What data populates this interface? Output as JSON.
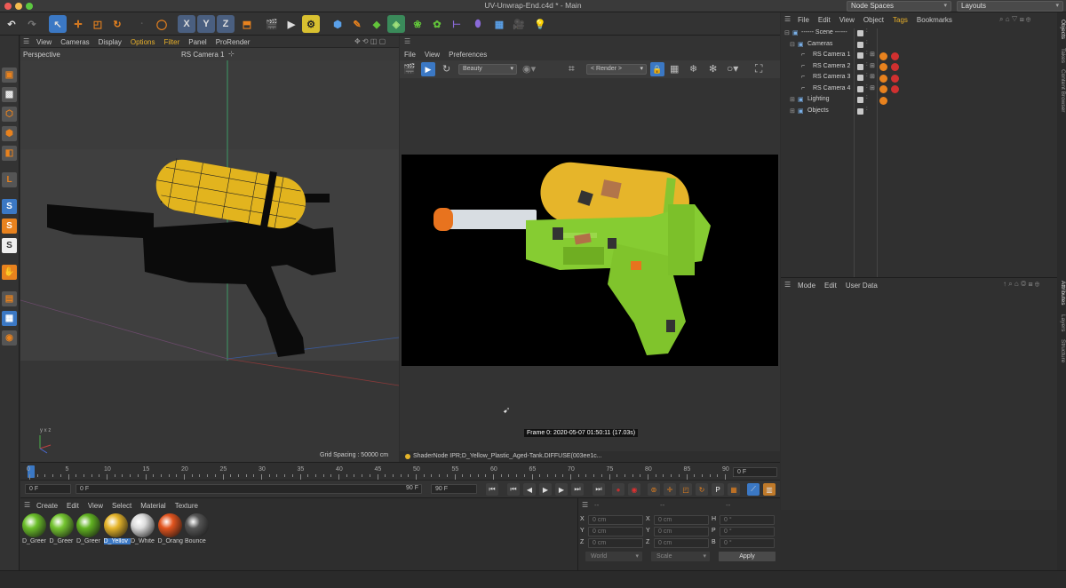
{
  "window": {
    "title": "UV-Unwrap-End.c4d * - Main",
    "node_spaces": "Node Spaces",
    "layouts": "Layouts"
  },
  "colors": {
    "accent_blue": "#3b78c4",
    "red_tag": "#d03030",
    "orange": "#e8821e",
    "yellow": "#e8c12c",
    "green": "#8bd13a"
  },
  "viewport1": {
    "menu": [
      "View",
      "Cameras",
      "Display",
      "Options",
      "Filter",
      "Panel",
      "ProRender"
    ],
    "label": "Perspective",
    "camera": "RS Camera 1",
    "grid_spacing": "Grid Spacing : 50000 cm"
  },
  "render_view": {
    "menu": [
      "File",
      "View",
      "Preferences"
    ],
    "pass": "Beauty",
    "render_dd": "< Render >",
    "frame_info": "Frame  0:  2020-05-07  01:50:11  (17.03s)",
    "shader_info": "ShaderNode IPR;D_Yellow_Plastic_Aged-Tank.DIFFUSE(003ee1c..."
  },
  "object_manager": {
    "menu": [
      "File",
      "Edit",
      "View",
      "Object",
      "Tags",
      "Bookmarks"
    ],
    "rows": [
      {
        "label": "------ Scene ------",
        "indent": 0
      },
      {
        "label": "Cameras",
        "indent": 1
      },
      {
        "label": "RS Camera 1",
        "indent": 2
      },
      {
        "label": "RS Camera 2",
        "indent": 2
      },
      {
        "label": "RS Camera 3",
        "indent": 2
      },
      {
        "label": "RS Camera 4",
        "indent": 2
      },
      {
        "label": "Lighting",
        "indent": 1
      },
      {
        "label": "Objects",
        "indent": 1
      }
    ]
  },
  "attributes": {
    "menu": [
      "Mode",
      "Edit",
      "User Data"
    ]
  },
  "side_tabs": {
    "top": [
      "Objects",
      "Takes",
      "Content Browser"
    ],
    "bottom": [
      "Attributes",
      "Layers",
      "Structure"
    ]
  },
  "timeline": {
    "ticks": [
      "0",
      "5",
      "10",
      "15",
      "20",
      "25",
      "30",
      "35",
      "40",
      "45",
      "50",
      "55",
      "60",
      "65",
      "70",
      "75",
      "80",
      "85",
      "90"
    ],
    "current_frame": "0 F"
  },
  "controls": {
    "start": "0 F",
    "current": "0 F",
    "end": "90 F",
    "end2": "90 F"
  },
  "materials": {
    "menu": [
      "Create",
      "Edit",
      "View",
      "Select",
      "Material",
      "Texture"
    ],
    "items": [
      {
        "label": "D_Greer",
        "color": "#6bbf2a",
        "selected": false
      },
      {
        "label": "D_Greer",
        "color": "#74c530",
        "selected": false
      },
      {
        "label": "D_Greer",
        "color": "#62b422",
        "selected": false
      },
      {
        "label": "D_Yellov",
        "color": "#e6b52a",
        "selected": true
      },
      {
        "label": "D_White",
        "color": "#dcdcdc",
        "selected": false
      },
      {
        "label": "D_Orang",
        "color": "#e2541e",
        "selected": false
      },
      {
        "label": "Bounce",
        "color": "#555555",
        "selected": false
      }
    ]
  },
  "coordinates": {
    "header": [
      "--",
      "--",
      "--"
    ],
    "rows": [
      {
        "a": "X",
        "av": "0 cm",
        "b": "X",
        "bv": "0 cm",
        "c": "H",
        "cv": "0 °"
      },
      {
        "a": "Y",
        "av": "0 cm",
        "b": "Y",
        "bv": "0 cm",
        "c": "P",
        "cv": "0 °"
      },
      {
        "a": "Z",
        "av": "0 cm",
        "b": "Z",
        "bv": "0 cm",
        "c": "B",
        "cv": "0 °"
      }
    ],
    "world": "World",
    "scale": "Scale",
    "apply": "Apply"
  }
}
